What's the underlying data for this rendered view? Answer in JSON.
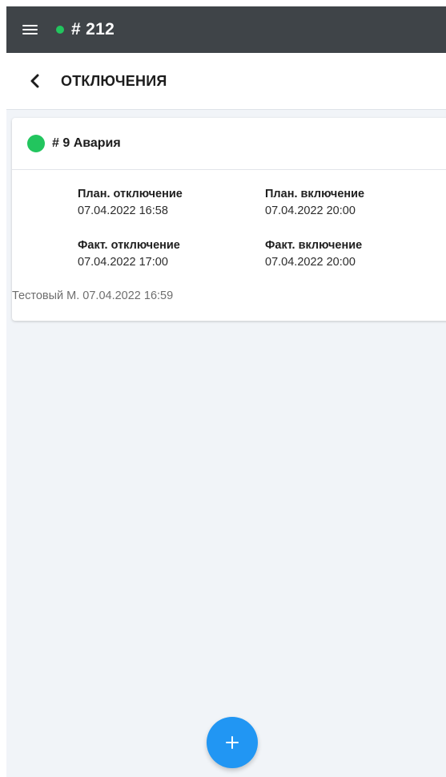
{
  "colors": {
    "appbar_bg": "#3f4448",
    "status_green": "#22c55e",
    "accent_blue": "#2196f3",
    "page_bg": "#f1f4f8"
  },
  "appbar": {
    "menu_icon": "hamburger-menu-icon",
    "title": "# 212"
  },
  "subheader": {
    "back_icon": "chevron-left-icon",
    "title": "ОТКЛЮЧЕНИЯ"
  },
  "outages": [
    {
      "title": "# 9  Авария",
      "plan_off_label": "План. отключение",
      "plan_off_value": "07.04.2022 16:58",
      "plan_on_label": "План. включение",
      "plan_on_value": "07.04.2022 20:00",
      "fact_off_label": "Факт. отключение",
      "fact_off_value": "07.04.2022 17:00",
      "fact_on_label": "Факт. включение",
      "fact_on_value": "07.04.2022 20:00",
      "author": "Тестовый М. 07.04.2022 16:59"
    }
  ],
  "fab": {
    "icon": "plus-icon"
  }
}
